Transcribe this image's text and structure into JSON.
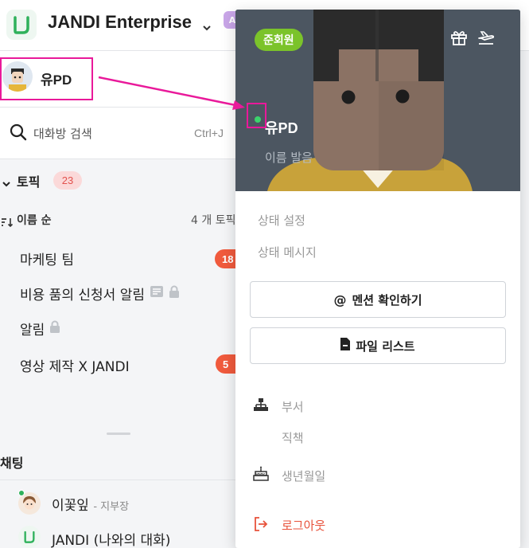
{
  "header": {
    "team_name": "JANDI Enterprise",
    "team_badge": "A"
  },
  "me": {
    "name": "유PD"
  },
  "search": {
    "placeholder": "대화방 검색",
    "shortcut": "Ctrl+J"
  },
  "topics": {
    "heading": "토픽",
    "count": "23",
    "sort_label": "이름 순",
    "total_label": "4 개 토픽",
    "items": [
      {
        "name": "마케팅 팀",
        "unread": "18"
      },
      {
        "name": "비용 품의 신청서 알림",
        "unread": ""
      },
      {
        "name": "알림",
        "unread": ""
      },
      {
        "name": "영상 제작 X JANDI",
        "unread": "5"
      }
    ]
  },
  "chats": {
    "heading": "채팅",
    "items": [
      {
        "name": "이꽃잎",
        "role": "- 지부장"
      },
      {
        "name": "JANDI (나와의 대화)",
        "role": ""
      }
    ]
  },
  "profile": {
    "role_pill": "준회원",
    "name": "유PD",
    "pronunciation": "이름 발음",
    "status_setting": "상태 설정",
    "status_message": "상태 메시지",
    "mention_button": "멘션 확인하기",
    "file_button": "파일 리스트",
    "department": "부서",
    "job_title": "직책",
    "birthday": "생년월일",
    "logout": "로그아웃"
  },
  "colors": {
    "brand_green": "#2fb15b",
    "highlight_magenta": "#e9199a",
    "unread_red": "#f05a3d",
    "role_pill_green": "#7bc32a",
    "logout_red": "#e8523b"
  }
}
